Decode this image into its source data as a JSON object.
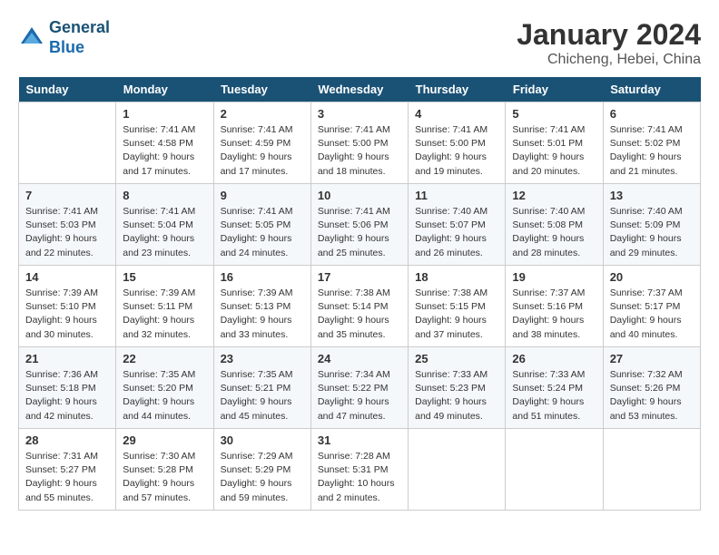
{
  "header": {
    "logo_line1": "General",
    "logo_line2": "Blue",
    "month": "January 2024",
    "location": "Chicheng, Hebei, China"
  },
  "days_of_week": [
    "Sunday",
    "Monday",
    "Tuesday",
    "Wednesday",
    "Thursday",
    "Friday",
    "Saturday"
  ],
  "weeks": [
    [
      {
        "num": "",
        "sunrise": "",
        "sunset": "",
        "daylight": ""
      },
      {
        "num": "1",
        "sunrise": "Sunrise: 7:41 AM",
        "sunset": "Sunset: 4:58 PM",
        "daylight": "Daylight: 9 hours and 17 minutes."
      },
      {
        "num": "2",
        "sunrise": "Sunrise: 7:41 AM",
        "sunset": "Sunset: 4:59 PM",
        "daylight": "Daylight: 9 hours and 17 minutes."
      },
      {
        "num": "3",
        "sunrise": "Sunrise: 7:41 AM",
        "sunset": "Sunset: 5:00 PM",
        "daylight": "Daylight: 9 hours and 18 minutes."
      },
      {
        "num": "4",
        "sunrise": "Sunrise: 7:41 AM",
        "sunset": "Sunset: 5:00 PM",
        "daylight": "Daylight: 9 hours and 19 minutes."
      },
      {
        "num": "5",
        "sunrise": "Sunrise: 7:41 AM",
        "sunset": "Sunset: 5:01 PM",
        "daylight": "Daylight: 9 hours and 20 minutes."
      },
      {
        "num": "6",
        "sunrise": "Sunrise: 7:41 AM",
        "sunset": "Sunset: 5:02 PM",
        "daylight": "Daylight: 9 hours and 21 minutes."
      }
    ],
    [
      {
        "num": "7",
        "sunrise": "Sunrise: 7:41 AM",
        "sunset": "Sunset: 5:03 PM",
        "daylight": "Daylight: 9 hours and 22 minutes."
      },
      {
        "num": "8",
        "sunrise": "Sunrise: 7:41 AM",
        "sunset": "Sunset: 5:04 PM",
        "daylight": "Daylight: 9 hours and 23 minutes."
      },
      {
        "num": "9",
        "sunrise": "Sunrise: 7:41 AM",
        "sunset": "Sunset: 5:05 PM",
        "daylight": "Daylight: 9 hours and 24 minutes."
      },
      {
        "num": "10",
        "sunrise": "Sunrise: 7:41 AM",
        "sunset": "Sunset: 5:06 PM",
        "daylight": "Daylight: 9 hours and 25 minutes."
      },
      {
        "num": "11",
        "sunrise": "Sunrise: 7:40 AM",
        "sunset": "Sunset: 5:07 PM",
        "daylight": "Daylight: 9 hours and 26 minutes."
      },
      {
        "num": "12",
        "sunrise": "Sunrise: 7:40 AM",
        "sunset": "Sunset: 5:08 PM",
        "daylight": "Daylight: 9 hours and 28 minutes."
      },
      {
        "num": "13",
        "sunrise": "Sunrise: 7:40 AM",
        "sunset": "Sunset: 5:09 PM",
        "daylight": "Daylight: 9 hours and 29 minutes."
      }
    ],
    [
      {
        "num": "14",
        "sunrise": "Sunrise: 7:39 AM",
        "sunset": "Sunset: 5:10 PM",
        "daylight": "Daylight: 9 hours and 30 minutes."
      },
      {
        "num": "15",
        "sunrise": "Sunrise: 7:39 AM",
        "sunset": "Sunset: 5:11 PM",
        "daylight": "Daylight: 9 hours and 32 minutes."
      },
      {
        "num": "16",
        "sunrise": "Sunrise: 7:39 AM",
        "sunset": "Sunset: 5:13 PM",
        "daylight": "Daylight: 9 hours and 33 minutes."
      },
      {
        "num": "17",
        "sunrise": "Sunrise: 7:38 AM",
        "sunset": "Sunset: 5:14 PM",
        "daylight": "Daylight: 9 hours and 35 minutes."
      },
      {
        "num": "18",
        "sunrise": "Sunrise: 7:38 AM",
        "sunset": "Sunset: 5:15 PM",
        "daylight": "Daylight: 9 hours and 37 minutes."
      },
      {
        "num": "19",
        "sunrise": "Sunrise: 7:37 AM",
        "sunset": "Sunset: 5:16 PM",
        "daylight": "Daylight: 9 hours and 38 minutes."
      },
      {
        "num": "20",
        "sunrise": "Sunrise: 7:37 AM",
        "sunset": "Sunset: 5:17 PM",
        "daylight": "Daylight: 9 hours and 40 minutes."
      }
    ],
    [
      {
        "num": "21",
        "sunrise": "Sunrise: 7:36 AM",
        "sunset": "Sunset: 5:18 PM",
        "daylight": "Daylight: 9 hours and 42 minutes."
      },
      {
        "num": "22",
        "sunrise": "Sunrise: 7:35 AM",
        "sunset": "Sunset: 5:20 PM",
        "daylight": "Daylight: 9 hours and 44 minutes."
      },
      {
        "num": "23",
        "sunrise": "Sunrise: 7:35 AM",
        "sunset": "Sunset: 5:21 PM",
        "daylight": "Daylight: 9 hours and 45 minutes."
      },
      {
        "num": "24",
        "sunrise": "Sunrise: 7:34 AM",
        "sunset": "Sunset: 5:22 PM",
        "daylight": "Daylight: 9 hours and 47 minutes."
      },
      {
        "num": "25",
        "sunrise": "Sunrise: 7:33 AM",
        "sunset": "Sunset: 5:23 PM",
        "daylight": "Daylight: 9 hours and 49 minutes."
      },
      {
        "num": "26",
        "sunrise": "Sunrise: 7:33 AM",
        "sunset": "Sunset: 5:24 PM",
        "daylight": "Daylight: 9 hours and 51 minutes."
      },
      {
        "num": "27",
        "sunrise": "Sunrise: 7:32 AM",
        "sunset": "Sunset: 5:26 PM",
        "daylight": "Daylight: 9 hours and 53 minutes."
      }
    ],
    [
      {
        "num": "28",
        "sunrise": "Sunrise: 7:31 AM",
        "sunset": "Sunset: 5:27 PM",
        "daylight": "Daylight: 9 hours and 55 minutes."
      },
      {
        "num": "29",
        "sunrise": "Sunrise: 7:30 AM",
        "sunset": "Sunset: 5:28 PM",
        "daylight": "Daylight: 9 hours and 57 minutes."
      },
      {
        "num": "30",
        "sunrise": "Sunrise: 7:29 AM",
        "sunset": "Sunset: 5:29 PM",
        "daylight": "Daylight: 9 hours and 59 minutes."
      },
      {
        "num": "31",
        "sunrise": "Sunrise: 7:28 AM",
        "sunset": "Sunset: 5:31 PM",
        "daylight": "Daylight: 10 hours and 2 minutes."
      },
      {
        "num": "",
        "sunrise": "",
        "sunset": "",
        "daylight": ""
      },
      {
        "num": "",
        "sunrise": "",
        "sunset": "",
        "daylight": ""
      },
      {
        "num": "",
        "sunrise": "",
        "sunset": "",
        "daylight": ""
      }
    ]
  ]
}
